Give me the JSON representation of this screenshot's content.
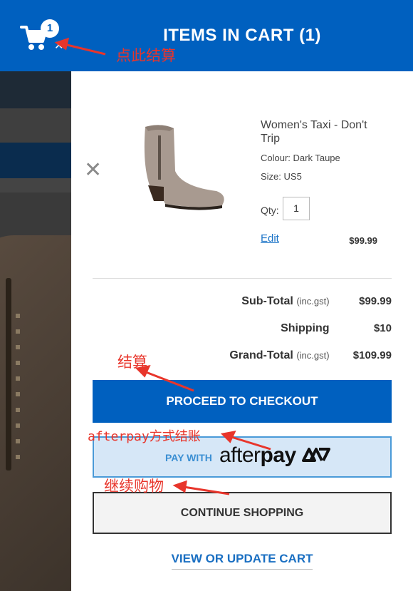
{
  "header": {
    "title": "ITEMS IN CART  (1)",
    "cart_count": "1",
    "close_glyph": "✕",
    "cart_icon": "shopping-cart-icon"
  },
  "item": {
    "name": "Women's Taxi - Don't Trip",
    "colour": "Colour: Dark Taupe",
    "size": "Size: US5",
    "qty_label": "Qty:",
    "qty": "1",
    "edit_label": "Edit",
    "price": "$99.99",
    "remove_glyph": "✕"
  },
  "summary": {
    "subtotal_label": "Sub-Total",
    "subtotal_note": "(inc.gst)",
    "subtotal_value": "$99.99",
    "shipping_label": "Shipping",
    "shipping_value": "$10",
    "grandtotal_label": "Grand-Total",
    "grandtotal_note": "(inc.gst)",
    "grandtotal_value": "$109.99"
  },
  "actions": {
    "checkout_label": "PROCEED TO CHECKOUT",
    "afterpay_prefix": "PAY WITH",
    "afterpay_brand_light": "after",
    "afterpay_brand_bold": "pay",
    "continue_label": "CONTINUE SHOPPING",
    "view_cart_label": "VIEW OR UPDATE CART"
  },
  "annotations": {
    "checkout_here": "点此结算",
    "checkout": "结算",
    "afterpay_checkout": "afterpay方式结账",
    "continue_shopping": "继续购物",
    "color": "#e8352b"
  },
  "colors": {
    "brand_blue": "#0060bf",
    "link_blue": "#1a6fc2",
    "afterpay_bg": "#d6e7f7"
  }
}
